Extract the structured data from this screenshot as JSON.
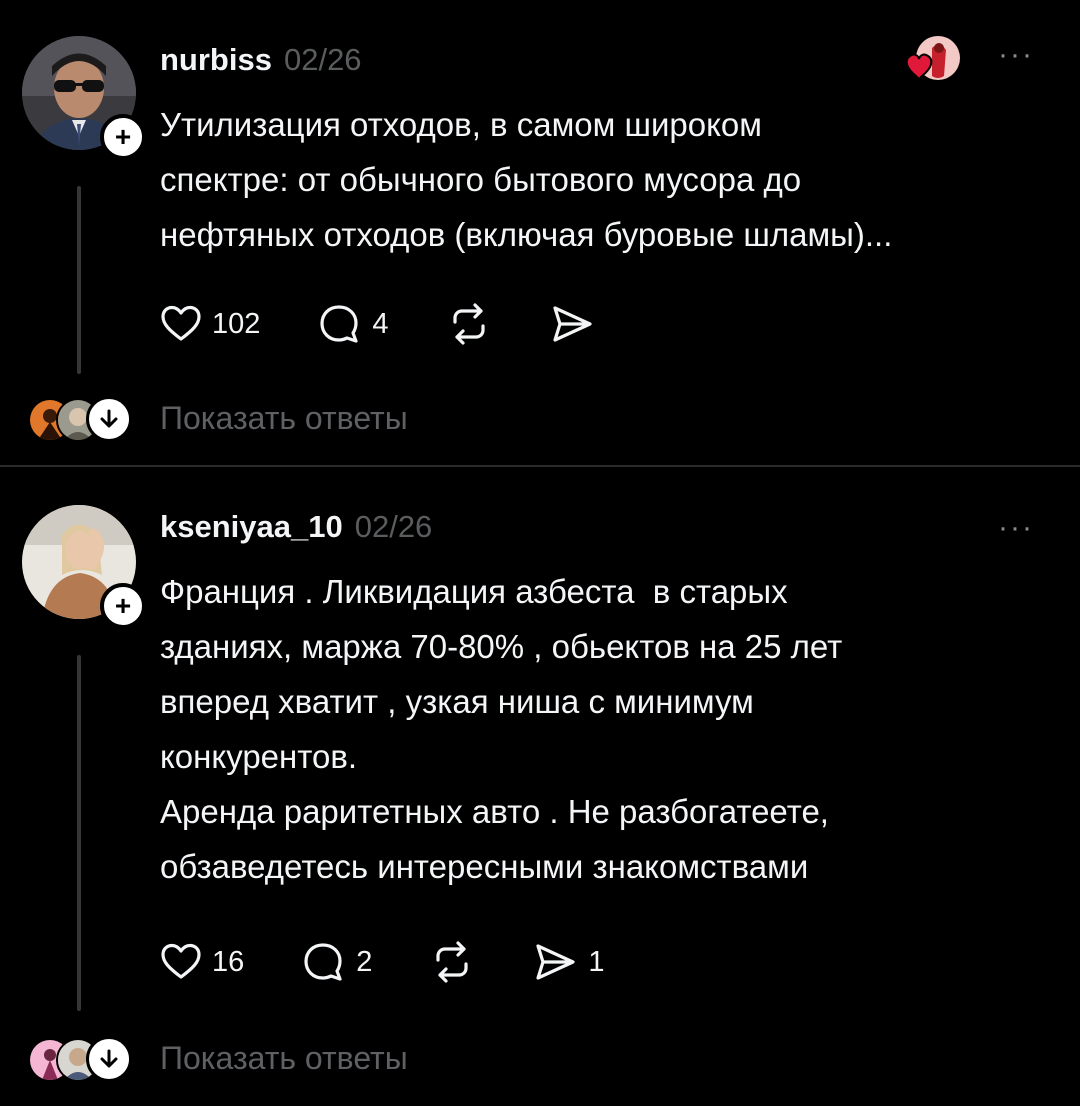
{
  "posts": [
    {
      "username": "nurbiss",
      "date": "02/26",
      "text": "Утилизация отходов, в самом широком\nспектре: от обычного бытового мусора до\nнефтяных отходов (включая буровые шламы)...",
      "likes": "102",
      "comments": "4",
      "shares": "",
      "show_replies": "Показать ответы",
      "more": "···"
    },
    {
      "username": "kseniyaa_10",
      "date": "02/26",
      "text": "Франция . Ликвидация азбеста  в старых\nзданиях, маржа 70-80% , обьектов на 25 лет\nвперед хватит , узкая ниша с минимум\nконкурентов.\nАренда раритетных авто . Не разбогатеете,\nобзаведетесь интересными знакомствами",
      "likes": "16",
      "comments": "2",
      "shares": "1",
      "show_replies": "Показать ответы",
      "more": "···"
    }
  ],
  "icons": {
    "like": "heart-icon",
    "comment": "comment-bubble-icon",
    "repost": "repost-icon",
    "share": "send-icon",
    "follow": "plus-icon",
    "expand": "arrow-down-icon"
  },
  "colors": {
    "background": "#000000",
    "text": "#f3f5f7",
    "muted": "#5a5c5e",
    "divider": "#2a2b2d",
    "reaction_heart": "#e0193a"
  }
}
